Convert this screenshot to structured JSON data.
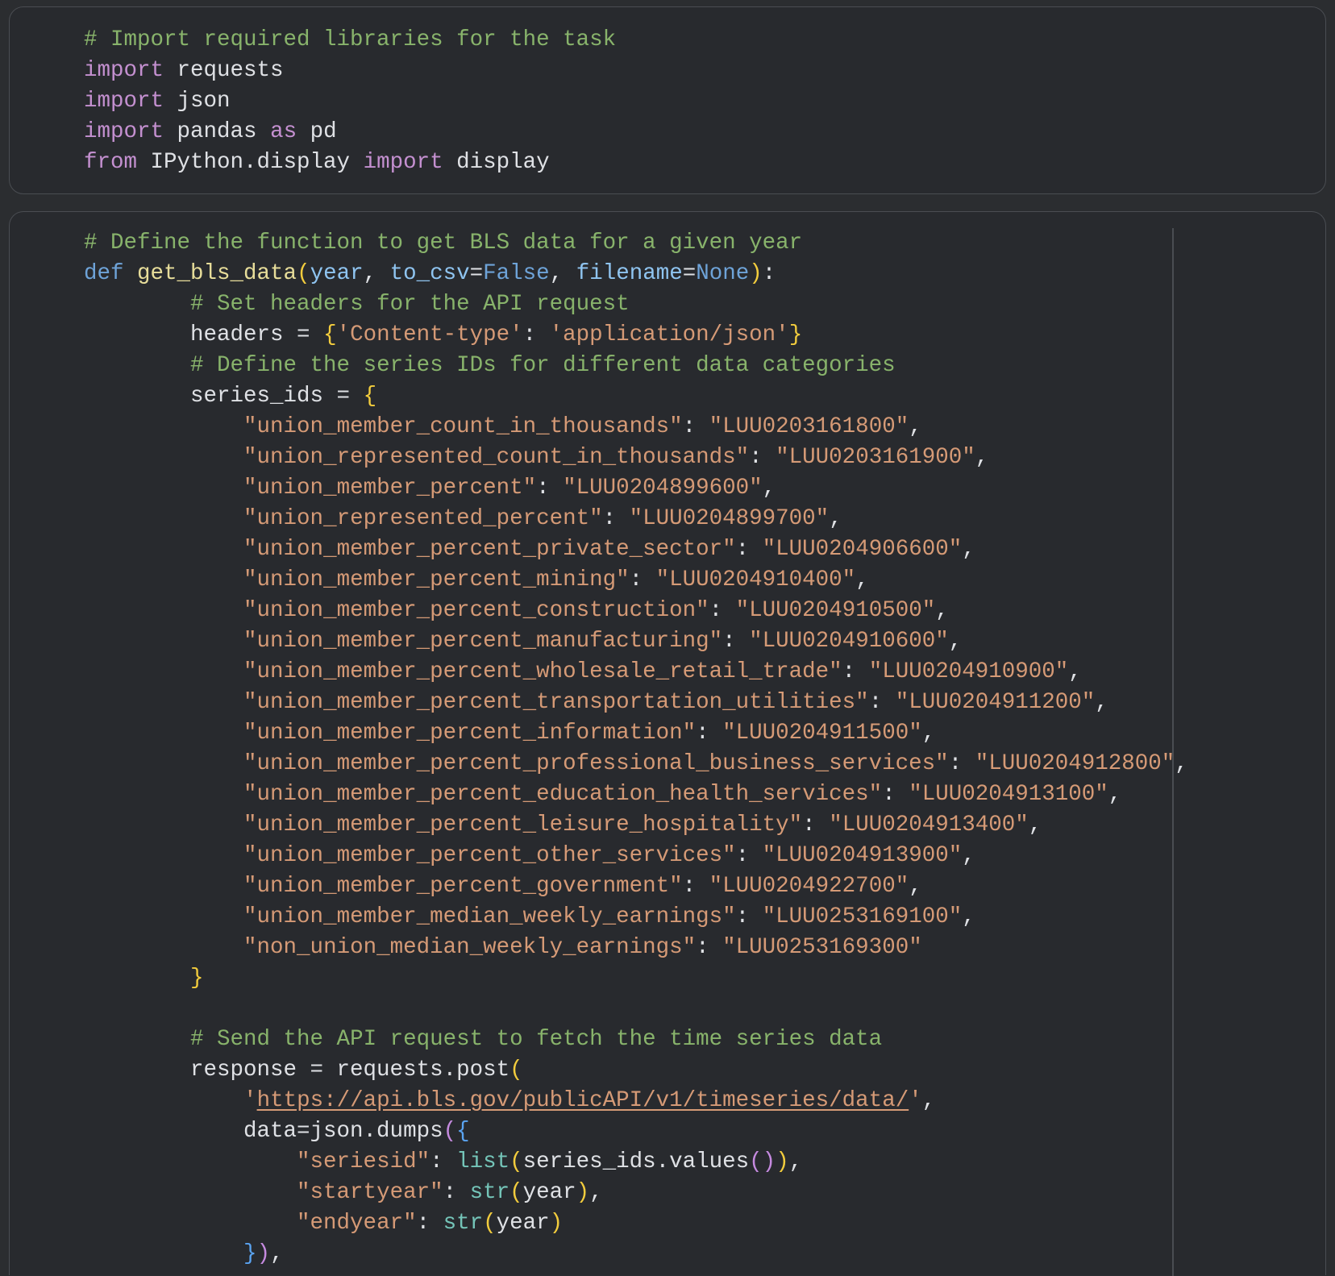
{
  "colors": {
    "background": "#2b2d30",
    "cell_background": "#282a2e",
    "cell_border": "#4a4d52",
    "comment": "#88b36b",
    "keyword": "#c490d0",
    "def_keyword": "#6ea3d8",
    "function_name": "#e7dd9a",
    "parameter": "#8fc4f0",
    "string": "#d59a76",
    "bracket_level_1": "#f2cc3d",
    "bracket_level_2": "#c58adf",
    "bracket_level_3": "#5aa3f0",
    "builtin": "#74c4b8",
    "plain": "#dfe1e5"
  },
  "cells": [
    {
      "name": "import-cell",
      "lines": [
        [
          {
            "t": "# Import required libraries for the task",
            "c": "comment"
          }
        ],
        [
          {
            "t": "import",
            "c": "kw"
          },
          {
            "t": " requests",
            "c": "plain"
          }
        ],
        [
          {
            "t": "import",
            "c": "kw"
          },
          {
            "t": " json",
            "c": "plain"
          }
        ],
        [
          {
            "t": "import",
            "c": "kw"
          },
          {
            "t": " pandas ",
            "c": "plain"
          },
          {
            "t": "as",
            "c": "kw"
          },
          {
            "t": " pd",
            "c": "plain"
          }
        ],
        [
          {
            "t": "from",
            "c": "kw"
          },
          {
            "t": " IPython.display ",
            "c": "plain"
          },
          {
            "t": "import",
            "c": "kw"
          },
          {
            "t": " display",
            "c": "plain"
          }
        ]
      ]
    },
    {
      "name": "function-cell",
      "lines": [
        [
          {
            "t": "# Define the function to get BLS data for a given year",
            "c": "comment"
          }
        ],
        [
          {
            "t": "def",
            "c": "def"
          },
          {
            "t": " ",
            "c": "plain"
          },
          {
            "t": "get_bls_data",
            "c": "func"
          },
          {
            "t": "(",
            "c": "b1"
          },
          {
            "t": "year",
            "c": "param"
          },
          {
            "t": ", ",
            "c": "plain"
          },
          {
            "t": "to_csv",
            "c": "param"
          },
          {
            "t": "=",
            "c": "plain"
          },
          {
            "t": "False",
            "c": "const"
          },
          {
            "t": ", ",
            "c": "plain"
          },
          {
            "t": "filename",
            "c": "param"
          },
          {
            "t": "=",
            "c": "plain"
          },
          {
            "t": "None",
            "c": "const"
          },
          {
            "t": ")",
            "c": "b1"
          },
          {
            "t": ":",
            "c": "plain"
          }
        ],
        [
          {
            "t": "        ",
            "c": "plain"
          },
          {
            "t": "# Set headers for the API request",
            "c": "comment"
          }
        ],
        [
          {
            "t": "        headers = ",
            "c": "plain"
          },
          {
            "t": "{",
            "c": "b1"
          },
          {
            "t": "'Content-type'",
            "c": "str"
          },
          {
            "t": ": ",
            "c": "plain"
          },
          {
            "t": "'application/json'",
            "c": "str"
          },
          {
            "t": "}",
            "c": "b1"
          }
        ],
        [
          {
            "t": "        ",
            "c": "plain"
          },
          {
            "t": "# Define the series IDs for different data categories",
            "c": "comment"
          }
        ],
        [
          {
            "t": "        series_ids = ",
            "c": "plain"
          },
          {
            "t": "{",
            "c": "b1"
          }
        ],
        [
          {
            "t": "            ",
            "c": "plain"
          },
          {
            "t": "\"union_member_count_in_thousands\"",
            "c": "str"
          },
          {
            "t": ": ",
            "c": "plain"
          },
          {
            "t": "\"LUU0203161800\"",
            "c": "str"
          },
          {
            "t": ",",
            "c": "plain"
          }
        ],
        [
          {
            "t": "            ",
            "c": "plain"
          },
          {
            "t": "\"union_represented_count_in_thousands\"",
            "c": "str"
          },
          {
            "t": ": ",
            "c": "plain"
          },
          {
            "t": "\"LUU0203161900\"",
            "c": "str"
          },
          {
            "t": ",",
            "c": "plain"
          }
        ],
        [
          {
            "t": "            ",
            "c": "plain"
          },
          {
            "t": "\"union_member_percent\"",
            "c": "str"
          },
          {
            "t": ": ",
            "c": "plain"
          },
          {
            "t": "\"LUU0204899600\"",
            "c": "str"
          },
          {
            "t": ",",
            "c": "plain"
          }
        ],
        [
          {
            "t": "            ",
            "c": "plain"
          },
          {
            "t": "\"union_represented_percent\"",
            "c": "str"
          },
          {
            "t": ": ",
            "c": "plain"
          },
          {
            "t": "\"LUU0204899700\"",
            "c": "str"
          },
          {
            "t": ",",
            "c": "plain"
          }
        ],
        [
          {
            "t": "            ",
            "c": "plain"
          },
          {
            "t": "\"union_member_percent_private_sector\"",
            "c": "str"
          },
          {
            "t": ": ",
            "c": "plain"
          },
          {
            "t": "\"LUU0204906600\"",
            "c": "str"
          },
          {
            "t": ",",
            "c": "plain"
          }
        ],
        [
          {
            "t": "            ",
            "c": "plain"
          },
          {
            "t": "\"union_member_percent_mining\"",
            "c": "str"
          },
          {
            "t": ": ",
            "c": "plain"
          },
          {
            "t": "\"LUU0204910400\"",
            "c": "str"
          },
          {
            "t": ",",
            "c": "plain"
          }
        ],
        [
          {
            "t": "            ",
            "c": "plain"
          },
          {
            "t": "\"union_member_percent_construction\"",
            "c": "str"
          },
          {
            "t": ": ",
            "c": "plain"
          },
          {
            "t": "\"LUU0204910500\"",
            "c": "str"
          },
          {
            "t": ",",
            "c": "plain"
          }
        ],
        [
          {
            "t": "            ",
            "c": "plain"
          },
          {
            "t": "\"union_member_percent_manufacturing\"",
            "c": "str"
          },
          {
            "t": ": ",
            "c": "plain"
          },
          {
            "t": "\"LUU0204910600\"",
            "c": "str"
          },
          {
            "t": ",",
            "c": "plain"
          }
        ],
        [
          {
            "t": "            ",
            "c": "plain"
          },
          {
            "t": "\"union_member_percent_wholesale_retail_trade\"",
            "c": "str"
          },
          {
            "t": ": ",
            "c": "plain"
          },
          {
            "t": "\"LUU0204910900\"",
            "c": "str"
          },
          {
            "t": ",",
            "c": "plain"
          }
        ],
        [
          {
            "t": "            ",
            "c": "plain"
          },
          {
            "t": "\"union_member_percent_transportation_utilities\"",
            "c": "str"
          },
          {
            "t": ": ",
            "c": "plain"
          },
          {
            "t": "\"LUU0204911200\"",
            "c": "str"
          },
          {
            "t": ",",
            "c": "plain"
          }
        ],
        [
          {
            "t": "            ",
            "c": "plain"
          },
          {
            "t": "\"union_member_percent_information\"",
            "c": "str"
          },
          {
            "t": ": ",
            "c": "plain"
          },
          {
            "t": "\"LUU0204911500\"",
            "c": "str"
          },
          {
            "t": ",",
            "c": "plain"
          }
        ],
        [
          {
            "t": "            ",
            "c": "plain"
          },
          {
            "t": "\"union_member_percent_professional_business_services\"",
            "c": "str"
          },
          {
            "t": ": ",
            "c": "plain"
          },
          {
            "t": "\"LUU0204912800\"",
            "c": "str"
          },
          {
            "t": ",",
            "c": "plain"
          }
        ],
        [
          {
            "t": "            ",
            "c": "plain"
          },
          {
            "t": "\"union_member_percent_education_health_services\"",
            "c": "str"
          },
          {
            "t": ": ",
            "c": "plain"
          },
          {
            "t": "\"LUU0204913100\"",
            "c": "str"
          },
          {
            "t": ",",
            "c": "plain"
          }
        ],
        [
          {
            "t": "            ",
            "c": "plain"
          },
          {
            "t": "\"union_member_percent_leisure_hospitality\"",
            "c": "str"
          },
          {
            "t": ": ",
            "c": "plain"
          },
          {
            "t": "\"LUU0204913400\"",
            "c": "str"
          },
          {
            "t": ",",
            "c": "plain"
          }
        ],
        [
          {
            "t": "            ",
            "c": "plain"
          },
          {
            "t": "\"union_member_percent_other_services\"",
            "c": "str"
          },
          {
            "t": ": ",
            "c": "plain"
          },
          {
            "t": "\"LUU0204913900\"",
            "c": "str"
          },
          {
            "t": ",",
            "c": "plain"
          }
        ],
        [
          {
            "t": "            ",
            "c": "plain"
          },
          {
            "t": "\"union_member_percent_government\"",
            "c": "str"
          },
          {
            "t": ": ",
            "c": "plain"
          },
          {
            "t": "\"LUU0204922700\"",
            "c": "str"
          },
          {
            "t": ",",
            "c": "plain"
          }
        ],
        [
          {
            "t": "            ",
            "c": "plain"
          },
          {
            "t": "\"union_member_median_weekly_earnings\"",
            "c": "str"
          },
          {
            "t": ": ",
            "c": "plain"
          },
          {
            "t": "\"LUU0253169100\"",
            "c": "str"
          },
          {
            "t": ",",
            "c": "plain"
          }
        ],
        [
          {
            "t": "            ",
            "c": "plain"
          },
          {
            "t": "\"non_union_median_weekly_earnings\"",
            "c": "str"
          },
          {
            "t": ": ",
            "c": "plain"
          },
          {
            "t": "\"LUU0253169300\"",
            "c": "str"
          }
        ],
        [
          {
            "t": "        ",
            "c": "plain"
          },
          {
            "t": "}",
            "c": "b1"
          }
        ],
        [
          {
            "t": "",
            "c": "plain"
          }
        ],
        [
          {
            "t": "        ",
            "c": "plain"
          },
          {
            "t": "# Send the API request to fetch the time series data",
            "c": "comment"
          }
        ],
        [
          {
            "t": "        response = requests.post",
            "c": "plain"
          },
          {
            "t": "(",
            "c": "b1"
          }
        ],
        [
          {
            "t": "            ",
            "c": "plain"
          },
          {
            "t": "'",
            "c": "str"
          },
          {
            "t": "https://api.bls.gov/publicAPI/v1/timeseries/data/",
            "c": "url"
          },
          {
            "t": "'",
            "c": "str"
          },
          {
            "t": ",",
            "c": "plain"
          }
        ],
        [
          {
            "t": "            data=json.dumps",
            "c": "plain"
          },
          {
            "t": "(",
            "c": "b2"
          },
          {
            "t": "{",
            "c": "b3"
          }
        ],
        [
          {
            "t": "                ",
            "c": "plain"
          },
          {
            "t": "\"seriesid\"",
            "c": "str"
          },
          {
            "t": ": ",
            "c": "plain"
          },
          {
            "t": "list",
            "c": "builtin"
          },
          {
            "t": "(",
            "c": "b1"
          },
          {
            "t": "series_ids.values",
            "c": "plain"
          },
          {
            "t": "()",
            "c": "b2"
          },
          {
            "t": ")",
            "c": "b1"
          },
          {
            "t": ",",
            "c": "plain"
          }
        ],
        [
          {
            "t": "                ",
            "c": "plain"
          },
          {
            "t": "\"startyear\"",
            "c": "str"
          },
          {
            "t": ": ",
            "c": "plain"
          },
          {
            "t": "str",
            "c": "builtin"
          },
          {
            "t": "(",
            "c": "b1"
          },
          {
            "t": "year",
            "c": "plain"
          },
          {
            "t": ")",
            "c": "b1"
          },
          {
            "t": ",",
            "c": "plain"
          }
        ],
        [
          {
            "t": "                ",
            "c": "plain"
          },
          {
            "t": "\"endyear\"",
            "c": "str"
          },
          {
            "t": ": ",
            "c": "plain"
          },
          {
            "t": "str",
            "c": "builtin"
          },
          {
            "t": "(",
            "c": "b1"
          },
          {
            "t": "year",
            "c": "plain"
          },
          {
            "t": ")",
            "c": "b1"
          }
        ],
        [
          {
            "t": "            ",
            "c": "plain"
          },
          {
            "t": "}",
            "c": "b3"
          },
          {
            "t": ")",
            "c": "b2"
          },
          {
            "t": ",",
            "c": "plain"
          }
        ]
      ]
    }
  ]
}
